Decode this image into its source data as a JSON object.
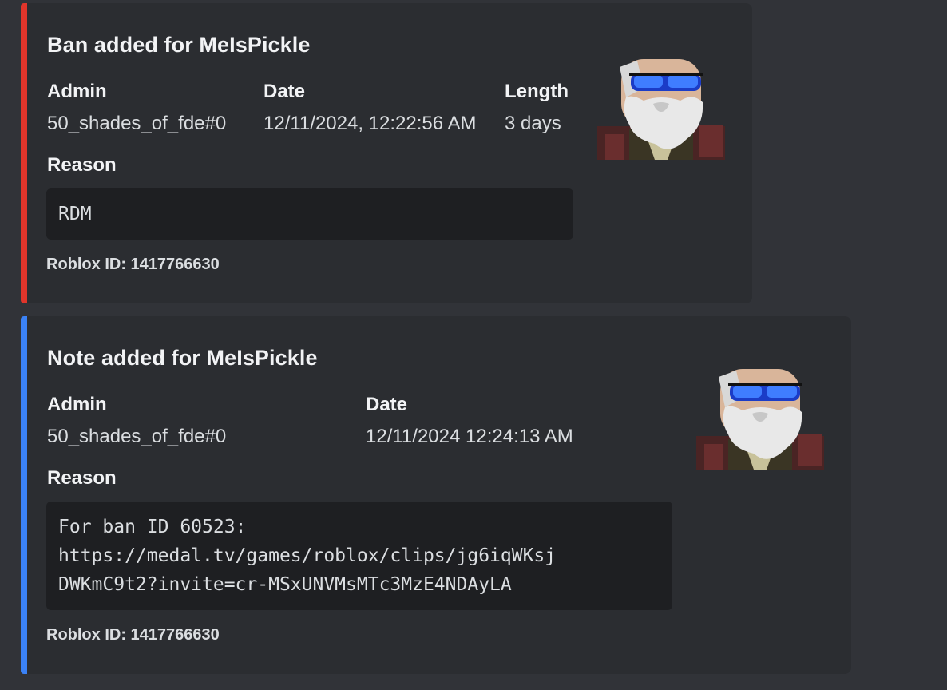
{
  "colors": {
    "ban_accent": "#e0352b",
    "note_accent": "#3b82f6",
    "embed_bg": "#2b2d31",
    "page_bg": "#313338"
  },
  "embeds": [
    {
      "title": "Ban added for MeIsPickle",
      "fields": [
        {
          "name": "Admin",
          "value": "50_shades_of_fde#0"
        },
        {
          "name": "Date",
          "value": "12/11/2024, 12:22:56 AM"
        },
        {
          "name": "Length",
          "value": "3 days"
        }
      ],
      "reason_label": "Reason",
      "reason_text": "RDM",
      "footer": "Roblox ID: 1417766630",
      "thumbnail_icon": "roblox-avatar-sunglasses-beard"
    },
    {
      "title": "Note added for MeIsPickle",
      "fields": [
        {
          "name": "Admin",
          "value": "50_shades_of_fde#0"
        },
        {
          "name": "Date",
          "value": "12/11/2024 12:24:13 AM"
        }
      ],
      "reason_label": "Reason",
      "reason_lines": [
        "For ban ID 60523:",
        "https://medal.tv/games/roblox/clips/jg6iqWKsj",
        "DWKmC9t2?invite=cr-MSxUNVMsMTc3MzE4NDAyLA"
      ],
      "footer": "Roblox ID: 1417766630",
      "thumbnail_icon": "roblox-avatar-sunglasses-beard"
    }
  ]
}
